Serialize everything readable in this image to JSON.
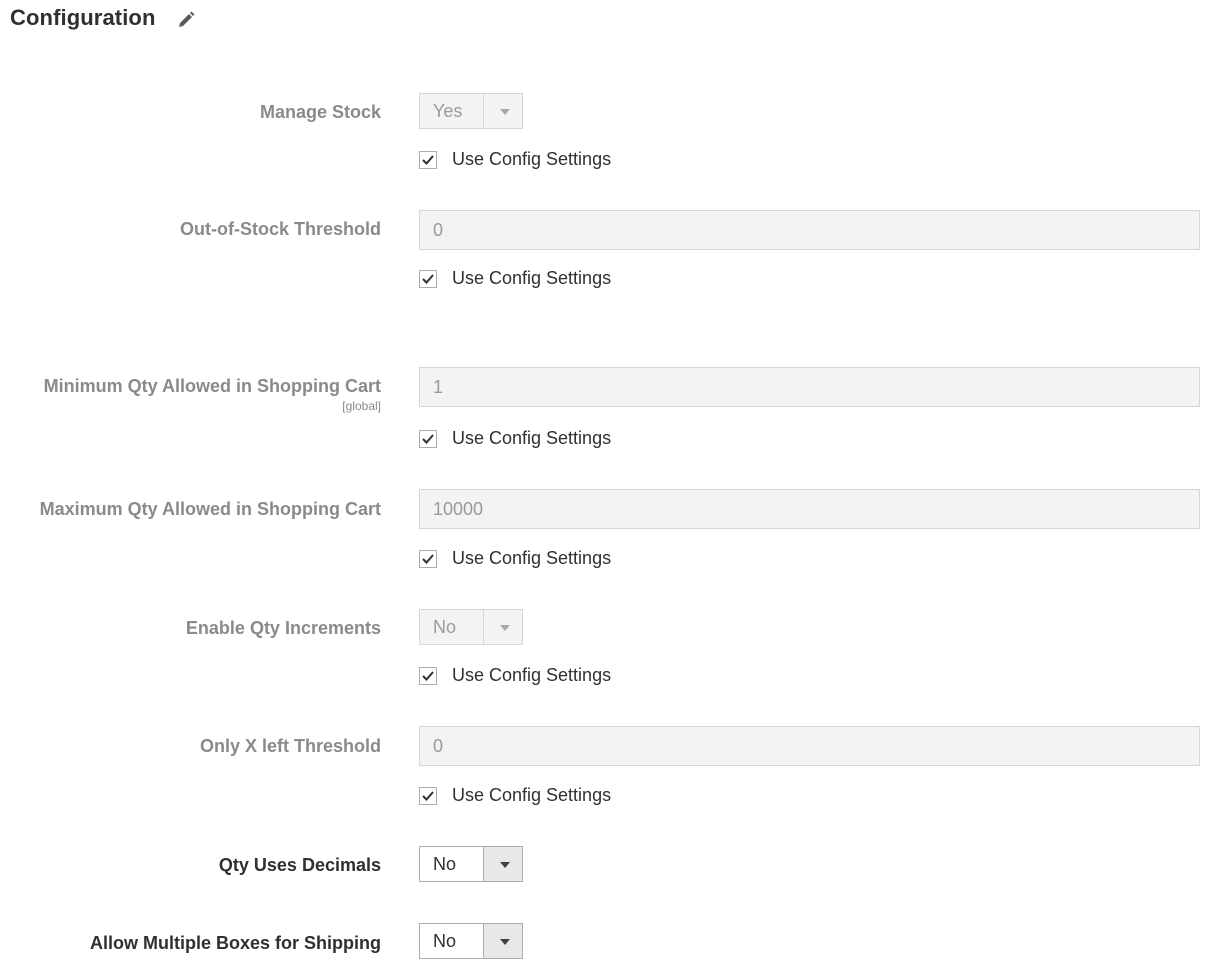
{
  "header": {
    "title": "Configuration",
    "edit_icon": "pencil-icon"
  },
  "fields": {
    "manage_stock": {
      "label": "Manage Stock",
      "value": "Yes",
      "use_config": "Use Config Settings",
      "use_config_checked": true,
      "disabled": true
    },
    "out_of_stock_threshold": {
      "label": "Out-of-Stock Threshold",
      "value": "0",
      "use_config": "Use Config Settings",
      "use_config_checked": true,
      "disabled": true
    },
    "min_qty_cart": {
      "label": "Minimum Qty Allowed in Shopping Cart",
      "scope": "[global]",
      "value": "1",
      "use_config": "Use Config Settings",
      "use_config_checked": true,
      "disabled": true
    },
    "max_qty_cart": {
      "label": "Maximum Qty Allowed in Shopping Cart",
      "value": "10000",
      "use_config": "Use Config Settings",
      "use_config_checked": true,
      "disabled": true
    },
    "enable_qty_increments": {
      "label": "Enable Qty Increments",
      "value": "No",
      "use_config": "Use Config Settings",
      "use_config_checked": true,
      "disabled": true
    },
    "only_x_left_threshold": {
      "label": "Only X left Threshold",
      "value": "0",
      "use_config": "Use Config Settings",
      "use_config_checked": true,
      "disabled": true
    },
    "qty_uses_decimals": {
      "label": "Qty Uses Decimals",
      "value": "No",
      "disabled": false
    },
    "allow_multiple_boxes": {
      "label": "Allow Multiple Boxes for Shipping",
      "value": "No",
      "disabled": false
    }
  },
  "colors": {
    "text": "#303030",
    "disabled_text": "#8a8a8a",
    "disabled_bg": "#f3f3f3",
    "border": "#adadad"
  }
}
